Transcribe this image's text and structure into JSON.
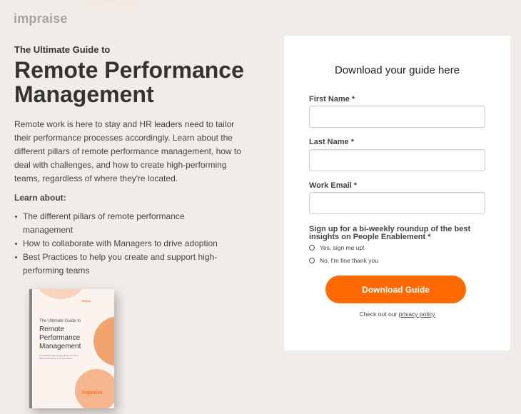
{
  "brand": {
    "logo_text": "impraise"
  },
  "hero": {
    "eyebrow": "The Ultimate Guide to",
    "headline": "Remote Performance Management",
    "intro": "Remote work is here to stay and HR leaders need to tailor their performance processes accordingly. Learn about the different pillars of remote performance management, how to deal with challenges, and how to create high-performing teams, regardless of where they're located.",
    "learn_heading": "Learn about:",
    "bullets": [
      "The different pillars of remote performance management",
      "How to collaborate with Managers to drive adoption",
      "Best Practices to help you create and support high-performing teams"
    ]
  },
  "book_cover": {
    "tag": "Ebook",
    "subtitle": "The Ultimate Guide to",
    "title": "Remote Performance Management",
    "description": "An practical step-by-step guide on how to drive performance in remote teams",
    "logo": "impraise"
  },
  "form": {
    "title": "Download your guide here",
    "fields": {
      "first_name": {
        "label": "First Name *",
        "value": ""
      },
      "last_name": {
        "label": "Last Name *",
        "value": ""
      },
      "work_email": {
        "label": "Work Email *",
        "value": ""
      }
    },
    "signup_question": "Sign up for a bi-weekly roundup of the best insights on People Enablement *",
    "options": [
      "Yes, sign me up!",
      "No, I'm fine thank you"
    ],
    "submit_label": "Download Guide",
    "privacy_prefix": "Check out our",
    "privacy_link": "privacy policy"
  },
  "colors": {
    "accent": "#ff6a00",
    "background": "#f1ece7"
  }
}
